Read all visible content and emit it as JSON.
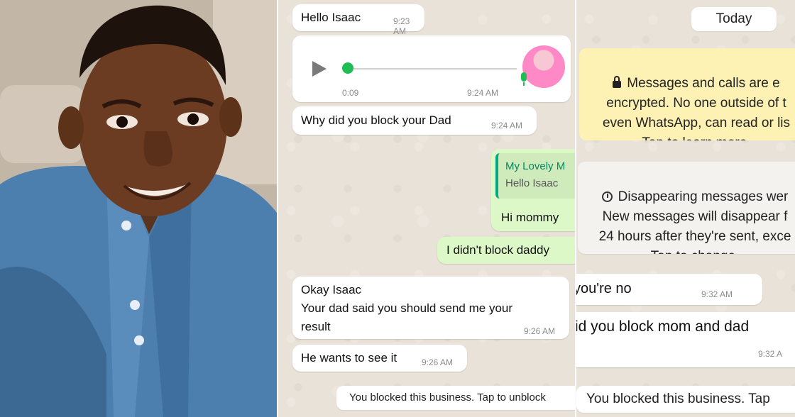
{
  "photo": {
    "subject": "boy-portrait"
  },
  "left_chat": {
    "msg1": {
      "text": "Hello Isaac",
      "time": "9:23 AM"
    },
    "voice": {
      "duration": "0:09",
      "time": "9:24 AM"
    },
    "msg2": {
      "text": "Why did you block your Dad",
      "time": "9:24 AM"
    },
    "reply": {
      "quoted_name": "My Lovely M",
      "quoted_text": "Hello Isaac",
      "text": "Hi mommy"
    },
    "msg3": {
      "text": "I didn't block daddy"
    },
    "msg4": {
      "text": "Okay Isaac\nYour dad said you should send me your\nresult",
      "time": "9:26 AM"
    },
    "msg5": {
      "text": "He wants to see it",
      "time": "9:26 AM"
    },
    "blocked_notice": "You blocked this business. Tap to unblock"
  },
  "right_chat": {
    "date_chip": "Today",
    "encryption_notice": "Messages and calls are e\nencrypted. No one outside of t\neven WhatsApp, can read or lis\nTap to learn more.",
    "disappearing_notice": "Disappearing messages wer\nNew messages will disappear f\n24 hours after they're sent, exce\nTap to change.",
    "msg1": {
      "text": "you're no",
      "time": "9:32 AM"
    },
    "msg2": {
      "text": "id you block mom and dad",
      "time": "9:32 A"
    },
    "blocked_notice": "You blocked this business. Tap"
  }
}
